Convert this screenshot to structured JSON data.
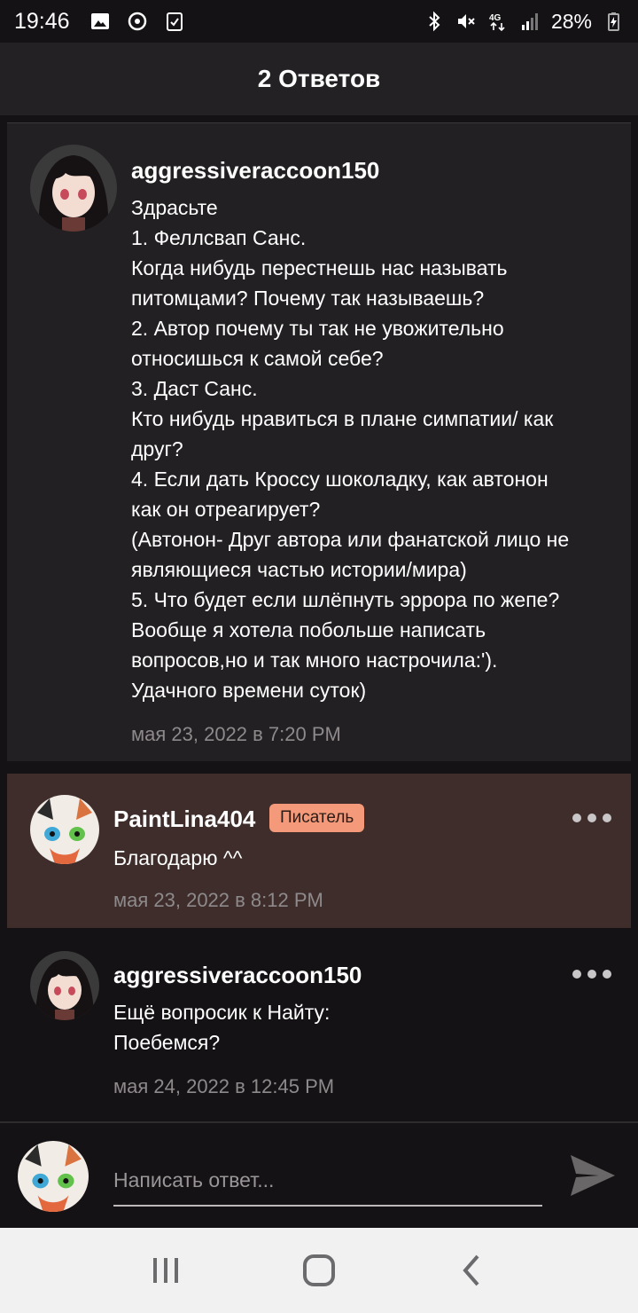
{
  "status_bar": {
    "time": "19:46",
    "battery_percent": "28%",
    "network": "4G",
    "icons": [
      "image-icon",
      "cloud-sync-icon",
      "clipboard-check-icon",
      "bluetooth-icon",
      "mute-icon",
      "signal-icon",
      "battery-charging-icon"
    ]
  },
  "header": {
    "title": "2 Ответов"
  },
  "comments": [
    {
      "username": "aggressiveraccoon150",
      "text": "Здрасьте\n1. Феллсвап Санс.\nКогда нибудь перестнешь нас называть\nпитомцами? Почему так называешь?\n2. Автор почему ты так не увожительно\nотносишься к самой себе?\n3. Даст Санс.\nКто нибудь нравиться в плане симпатии/ как\nдруг?\n4. Если дать Кроссу шоколадку, как автонон\nкак он отреагирует?\n(Автонон- Друг автора или фанатской лицо не\nявляющиеся частью истории/мира)\n5. Что будет если шлёпнуть эррора по жепе?\nВообще я хотела побольше написать\nвопросов,но и так много настрочила:').\nУдачного времени суток)",
      "timestamp": "мая 23, 2022 в 7:20 PM"
    },
    {
      "username": "PaintLina404",
      "badge": "Писатель",
      "text": "Благодарю ^^",
      "timestamp": "мая 23, 2022 в 8:12 PM",
      "highlight_color": "#3e2d2b"
    },
    {
      "username": "aggressiveraccoon150",
      "text": "Ещё вопросик к Найту:\nПоебемся?",
      "timestamp": "мая 24, 2022 в 12:45 PM"
    }
  ],
  "composer": {
    "placeholder": "Написать ответ...",
    "send_icon": "send-icon"
  },
  "nav_bar": {
    "buttons": [
      "recent-apps-icon",
      "home-icon",
      "back-icon"
    ]
  },
  "colors": {
    "background": "#141214",
    "header": "#232123",
    "card": "#222022",
    "writer_highlight": "#3e2d2b",
    "badge": "#f49a7a",
    "timestamp": "#8e8a8c"
  }
}
